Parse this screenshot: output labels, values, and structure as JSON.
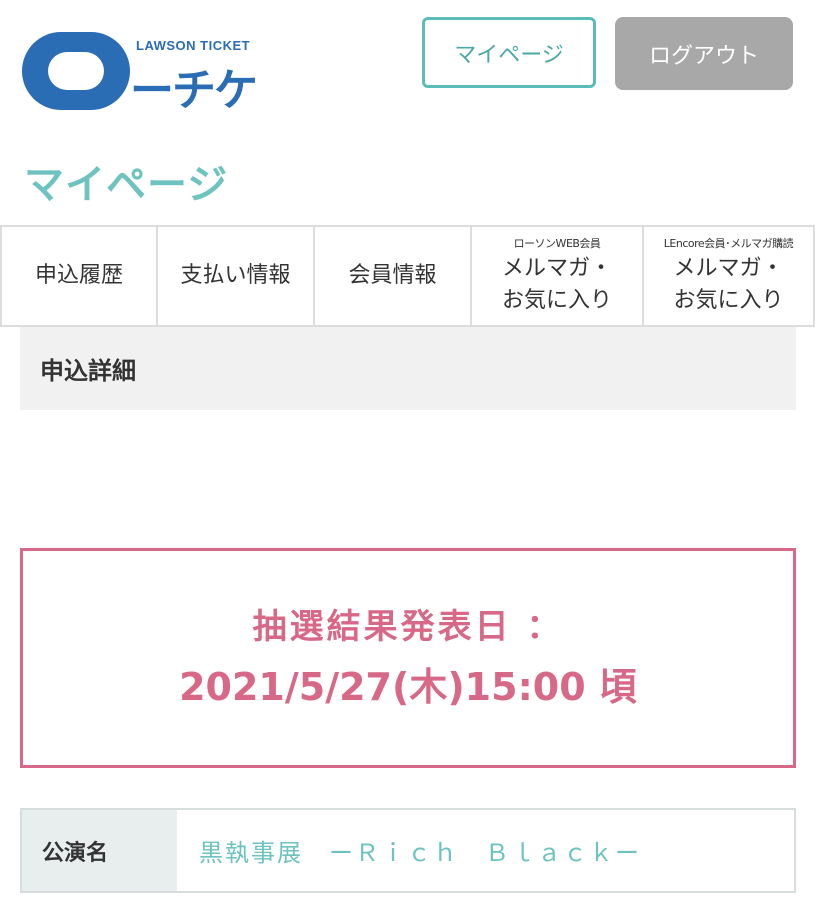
{
  "header": {
    "logo_brand": "LAWSON TICKET",
    "logo_text": "ーチケ",
    "mypage_button": "マイページ",
    "logout_button": "ログアウト"
  },
  "page_title": "マイページ",
  "tabs": [
    {
      "label": "申込履歴"
    },
    {
      "label": "支払い情報"
    },
    {
      "label": "会員情報"
    },
    {
      "sub": "ローソンWEB会員",
      "line1": "メルマガ・",
      "line2": "お気に入り"
    },
    {
      "sub": "LEncore会員･メルマガ購読",
      "line1": "メルマガ・",
      "line2": "お気に入り"
    }
  ],
  "section": {
    "title": "申込詳細"
  },
  "lottery": {
    "label": "抽選結果発表日 ：",
    "date": "2021/5/27(木)15:00 頃"
  },
  "details": {
    "performance_key": "公演名",
    "performance_value": "黒執事展　ーＲｉｃｈ　Ｂｌａｃｋー"
  },
  "colors": {
    "accent": "#6cc3c0",
    "lottery": "#d86888",
    "logo": "#2a6db5"
  }
}
